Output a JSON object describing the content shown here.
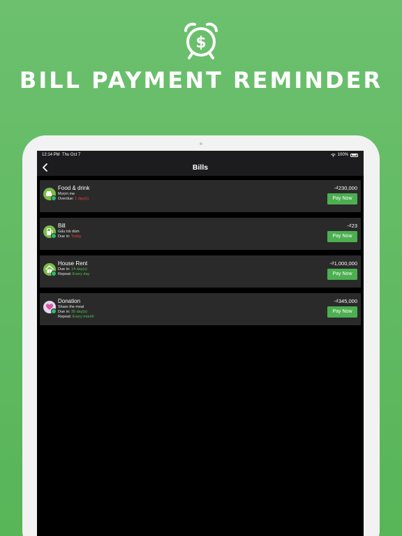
{
  "headline": "BILL PAYMENT REMINDER",
  "colors": {
    "background": "#60bb62",
    "accent": "#4caf50",
    "overdue": "#e9423b",
    "due_ok": "#4fc24a"
  },
  "status_bar": {
    "time": "12:14 PM",
    "date": "Thu Oct 7",
    "battery": "100%"
  },
  "nav": {
    "title": "Bills"
  },
  "bills": [
    {
      "name": "Food & drink",
      "note": "Mượn mẹ",
      "due_label": "Overdue:",
      "due_value": "1 day(s)",
      "due_status": "overdue",
      "amount": "-₫230,000",
      "pay_label": "Pay Now",
      "icon": "food-icon"
    },
    {
      "name": "Bill",
      "note": "Gấu trả dùm",
      "due_label": "Due in:",
      "due_value": "Today",
      "due_status": "overdue",
      "amount": "-₫23",
      "pay_label": "Pay Now",
      "icon": "gas-pump-icon"
    },
    {
      "name": "House Rent",
      "due_label": "Due in:",
      "due_value": "14 day(s)",
      "due_status": "ok",
      "repeat_label": "Repeat:",
      "repeat_value": "Every day",
      "amount": "-₫1,000,000",
      "pay_label": "Pay Now",
      "icon": "house-icon"
    },
    {
      "name": "Donation",
      "note": "Share the meal",
      "due_label": "Due in:",
      "due_value": "35 day(s)",
      "due_status": "ok",
      "repeat_label": "Repeat:",
      "repeat_value": "Every month",
      "amount": "-₫345,000",
      "pay_label": "Pay Now",
      "icon": "donation-icon"
    }
  ]
}
